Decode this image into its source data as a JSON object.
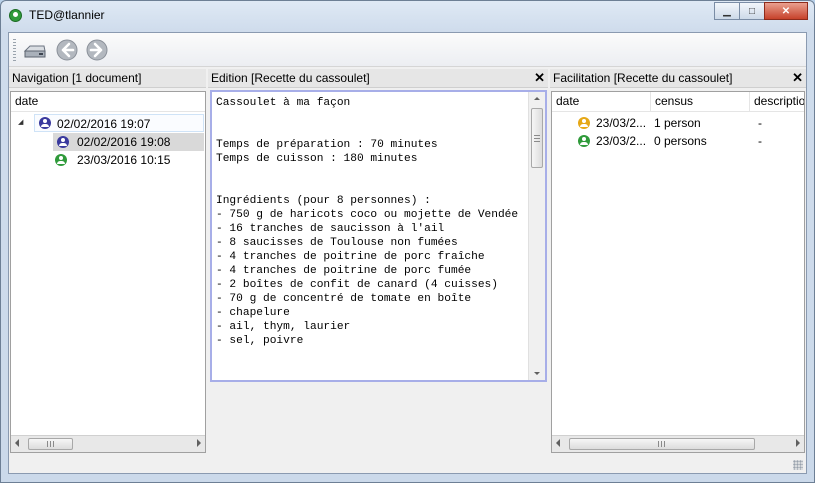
{
  "window": {
    "title": "TED@tlannier",
    "minimize_glyph": "▁",
    "maximize_glyph": "□",
    "close_glyph": "✕"
  },
  "toolbar": {
    "icons": [
      "drive-icon",
      "back-arrow-icon",
      "forward-arrow-icon"
    ]
  },
  "navigation": {
    "header": "Navigation [1 document]",
    "column": "date",
    "expander": "◢",
    "items": [
      {
        "label": "02/02/2016 19:07",
        "icon_color": "#3a3a9e"
      },
      {
        "label": "02/02/2016 19:08",
        "icon_color": "#3a3a9e"
      },
      {
        "label": "23/03/2016 10:15",
        "icon_color": "#2f9a3a"
      }
    ]
  },
  "edition": {
    "header": "Edition [Recette du cassoulet]",
    "close": "✕",
    "content": "Cassoulet à ma façon\n\n\nTemps de préparation : 70 minutes\nTemps de cuisson : 180 minutes\n\n\nIngrédients (pour 8 personnes) :\n- 750 g de haricots coco ou mojette de Vendée\n- 16 tranches de saucisson à l'ail\n- 8 saucisses de Toulouse non fumées\n- 4 tranches de poitrine de porc fraîche\n- 4 tranches de poitrine de porc fumée\n- 2 boîtes de confit de canard (4 cuisses)\n- 70 g de concentré de tomate en boîte\n- chapelure\n- ail, thym, laurier\n- sel, poivre"
  },
  "facilitation": {
    "header": "Facilitation [Recette du cassoulet]",
    "close": "✕",
    "columns": [
      "date",
      "census",
      "descriptio"
    ],
    "rows": [
      {
        "date": "23/03/2...",
        "census": "1 person",
        "description": "-",
        "icon_color": "#e6a817"
      },
      {
        "date": "23/03/2...",
        "census": "0 persons",
        "description": "-",
        "icon_color": "#2f9a3a"
      }
    ]
  }
}
